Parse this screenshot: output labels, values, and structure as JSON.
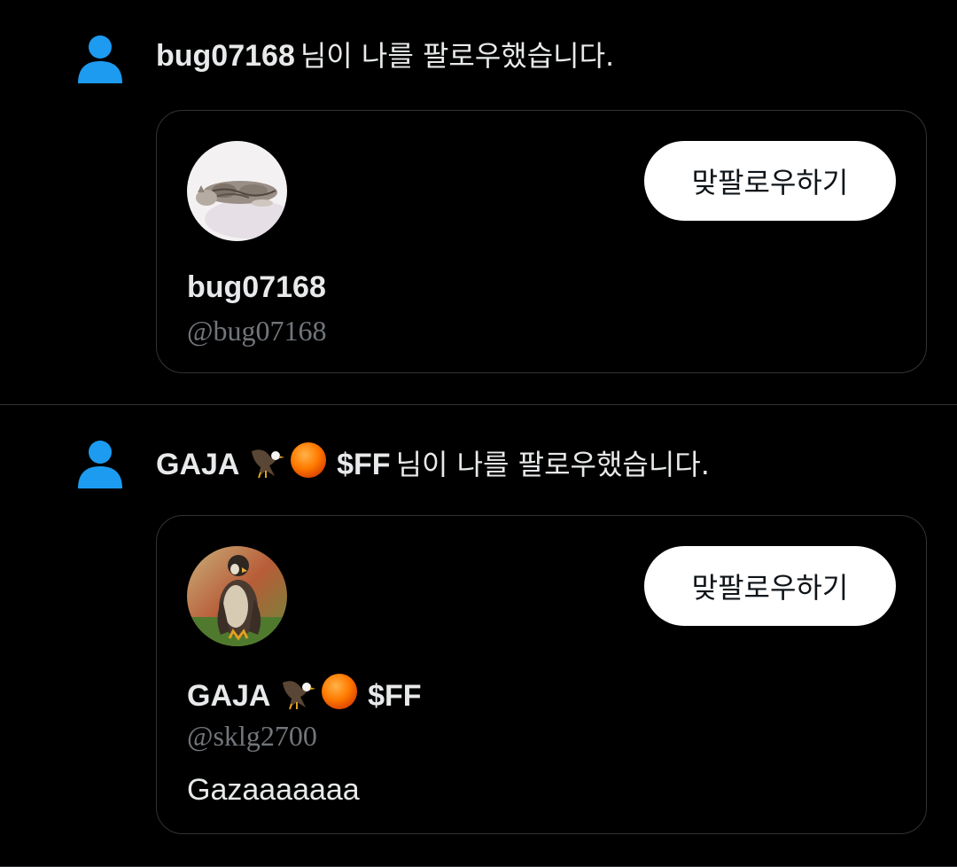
{
  "colors": {
    "background": "#000000",
    "accent_icon": "#1d9bf0",
    "button_bg": "#ffffff",
    "muted_text": "#71767b",
    "border": "#2f3336"
  },
  "notifications": [
    {
      "icon": "person-icon",
      "actor": "bug07168",
      "action_text": "님이 나를 팔로우했습니다.",
      "card": {
        "avatar": "cat-avatar",
        "display_name": "bug07168",
        "handle": "@bug07168",
        "follow_button": "맞팔로우하기"
      }
    },
    {
      "icon": "person-icon",
      "actor": "GAJA",
      "actor_suffix": "$FF",
      "actor_emojis": [
        "eagle-emoji",
        "orange-circle-emoji"
      ],
      "action_text": "님이 나를 팔로우했습니다.",
      "card": {
        "avatar": "falcon-avatar",
        "display_name": "GAJA",
        "display_name_suffix": "$FF",
        "handle": "@sklg2700",
        "bio": "Gazaaaaaaa",
        "follow_button": "맞팔로우하기"
      }
    }
  ]
}
